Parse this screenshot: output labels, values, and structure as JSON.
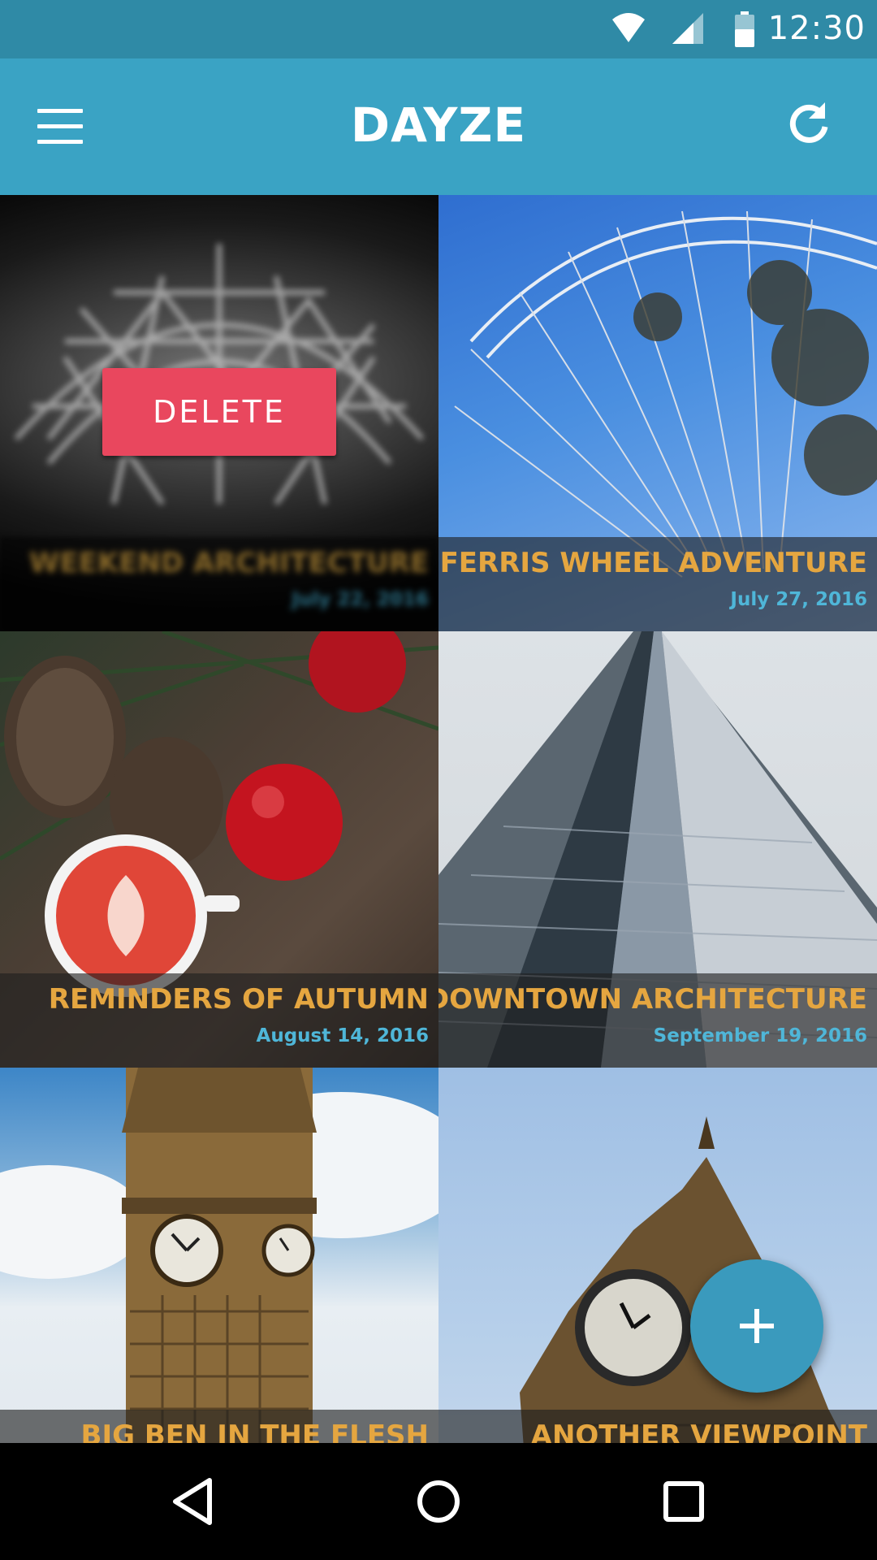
{
  "status_bar": {
    "time": "12:30",
    "icons": [
      "wifi-icon",
      "signal-icon",
      "battery-icon"
    ]
  },
  "app_bar": {
    "title": "DAYZE",
    "menu_icon": "menu-icon",
    "refresh_icon": "refresh-icon"
  },
  "colors": {
    "status_bar": "#2f8aa6",
    "app_bar": "#3aa3c4",
    "title_text": "#e5a640",
    "date_text": "#4fb6d8",
    "delete_button": "#e9475e",
    "fab": "#3a9abd"
  },
  "cards": [
    {
      "title": "WEEKEND ARCHITECTURE",
      "date": "July 22, 2016",
      "action": "DELETE",
      "photo": "blurred geodesic dome roof"
    },
    {
      "title": "FERRIS WHEEL ADVENTURE",
      "date": "July 27, 2016",
      "photo": "ferris wheel against blue sky"
    },
    {
      "title": "REMINDERS OF AUTUMN",
      "date": "August 14, 2016",
      "photo": "pine cones, apples and latte"
    },
    {
      "title": "DOWNTOWN ARCHITECTURE",
      "date": "September 19, 2016",
      "photo": "glass skyscraper from below"
    },
    {
      "title": "BIG BEN IN THE FLESH",
      "date": "",
      "photo": "Big Ben clock tower"
    },
    {
      "title": "ANOTHER VIEWPOINT",
      "date": "",
      "photo": "clock tower from below"
    }
  ],
  "fab": {
    "label": "+",
    "icon": "plus-icon"
  },
  "nav_bar": {
    "icons": [
      "back-icon",
      "home-icon",
      "recents-icon"
    ]
  }
}
